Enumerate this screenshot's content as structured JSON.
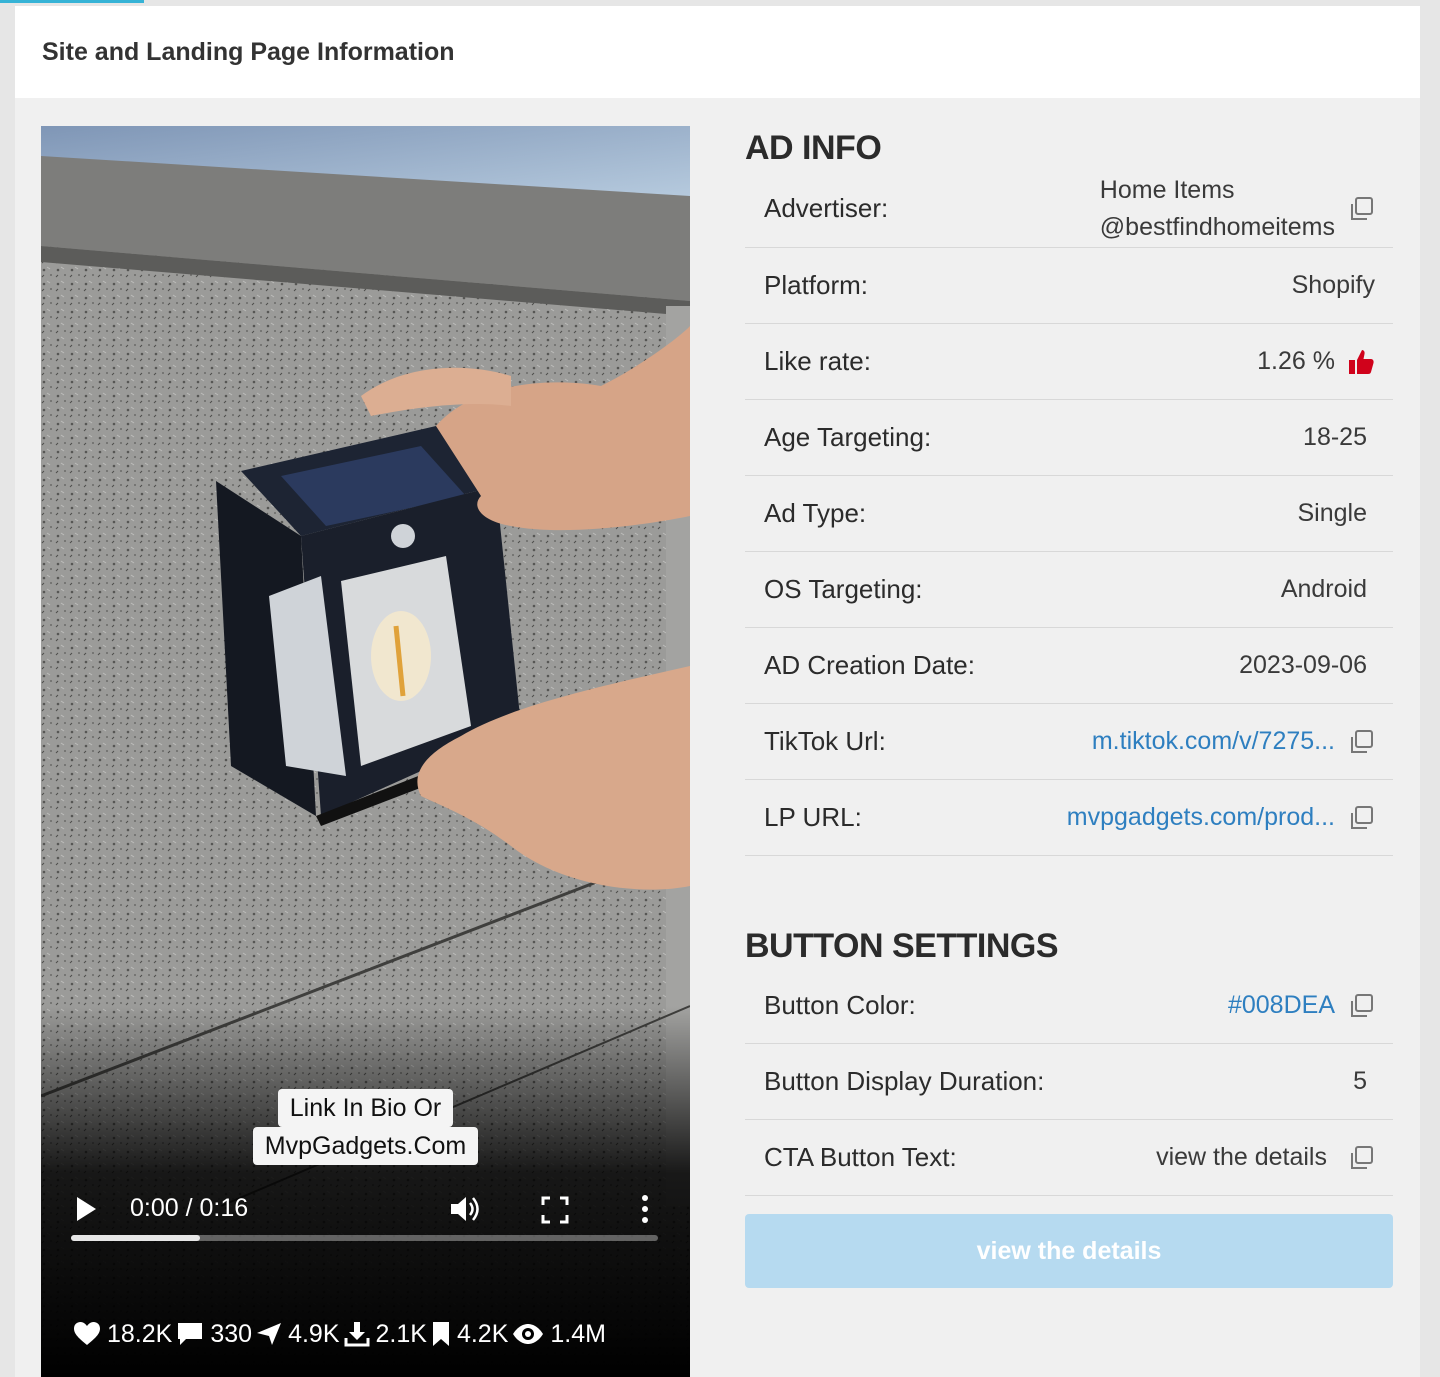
{
  "header": {
    "title": "Site and Landing Page Information"
  },
  "video": {
    "caption_line1": "Link In Bio Or",
    "caption_line2": "MvpGadgets.Com",
    "time": "0:00 / 0:16",
    "progress": 0.22,
    "stats": {
      "likes": "18.2K",
      "comments": "330",
      "shares": "4.9K",
      "downloads": "2.1K",
      "saves": "4.2K",
      "views": "1.4M"
    }
  },
  "ad_info": {
    "title": "AD INFO",
    "advertiser_label": "Advertiser:",
    "advertiser_name": "Home Items",
    "advertiser_handle": "@bestfindhomeitems",
    "platform_label": "Platform:",
    "platform_value": "Shopify",
    "like_rate_label": "Like rate:",
    "like_rate_value": "1.26 %",
    "age_label": "Age Targeting:",
    "age_value": "18-25",
    "ad_type_label": "Ad Type:",
    "ad_type_value": "Single",
    "os_label": "OS Targeting:",
    "os_value": "Android",
    "date_label": "AD Creation Date:",
    "date_value": "2023-09-06",
    "tiktok_label": "TikTok Url:",
    "tiktok_value": "m.tiktok.com/v/7275...",
    "lp_label": "LP URL:",
    "lp_value": "mvpgadgets.com/prod..."
  },
  "button_settings": {
    "title": "BUTTON SETTINGS",
    "color_label": "Button Color:",
    "color_value": "#008DEA",
    "duration_label": "Button Display Duration:",
    "duration_value": "5",
    "cta_label": "CTA Button Text:",
    "cta_value": "view the details",
    "cta_preview": "view the details"
  },
  "colors": {
    "link": "#2e7fc0",
    "like_icon": "#d0021b",
    "cta_preview_bg": "#b6daf0",
    "accent": "#36b3d6"
  },
  "icons": [
    "copy-icon",
    "thumbs-up-icon",
    "play-icon",
    "volume-icon",
    "fullscreen-icon",
    "more-vertical-icon",
    "heart-icon",
    "comment-icon",
    "share-icon",
    "download-icon",
    "bookmark-icon",
    "eye-icon"
  ]
}
